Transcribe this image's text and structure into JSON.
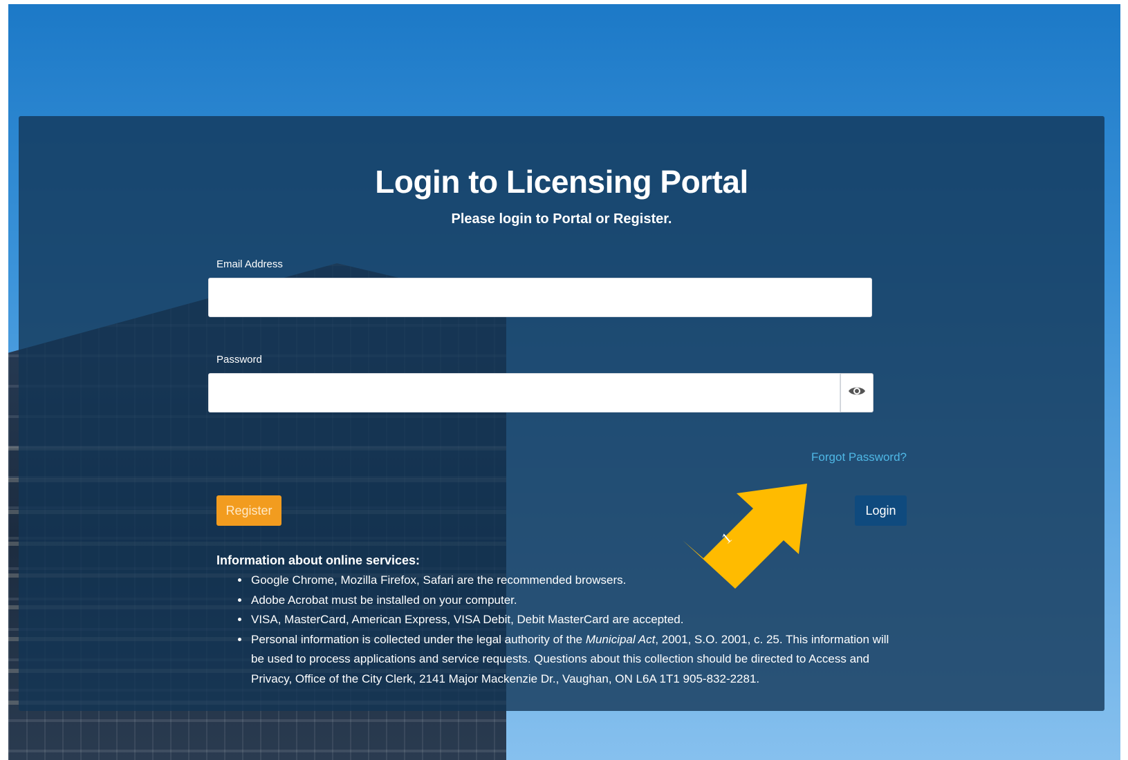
{
  "page": {
    "title": "Login to Licensing Portal",
    "subtitle": "Please login to Portal or Register."
  },
  "form": {
    "email_label": "Email Address",
    "email_value": "",
    "password_label": "Password",
    "password_value": "",
    "show_password_icon": "eye-icon",
    "forgot_password": "Forgot Password?",
    "register_label": "Register",
    "login_label": "Login"
  },
  "info": {
    "heading": "Information about online services:",
    "items": [
      "Google Chrome, Mozilla Firefox, Safari are the recommended browsers.",
      "Adobe Acrobat must be installed on your computer.",
      "VISA, MasterCard, American Express, VISA Debit, Debit MasterCard are accepted."
    ],
    "privacy_pre": "Personal information is collected under the legal authority of the ",
    "privacy_act": "Municipal Act",
    "privacy_post": ", 2001, S.O. 2001, c. 25. This information will be used to process applications and service requests. Questions about this collection should be directed to Access and Privacy, Office of the City Clerk, 2141 Major Mackenzie Dr., Vaughan, ON L6A 1T1 905-832-2281."
  },
  "annotation": {
    "arrow_label": "1",
    "arrow_color": "#ffbb00"
  },
  "colors": {
    "panel": "#123454",
    "register": "#f29c1f",
    "login": "#0f4a7e",
    "link": "#4fb8e6"
  }
}
